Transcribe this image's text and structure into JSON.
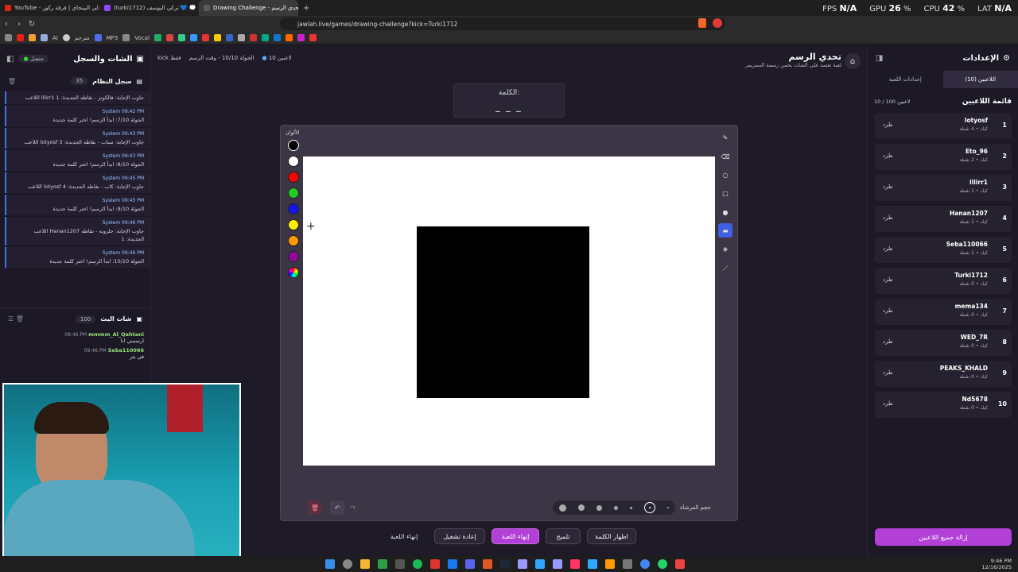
{
  "browser": {
    "tabs": [
      {
        "label": "YouTube - مبدلي البينجاي | فرقة ركوز",
        "color": "#e62117"
      },
      {
        "label": "(turki1712) تركي اليوسف 💙 💭",
        "color": "#9146ff"
      },
      {
        "label": "Drawing Challenge - تحدي الرسم",
        "color": "#5a5a5a",
        "active": true
      }
    ],
    "url": "jawlah.live/games/drawing-challenge?kick=Turki1712",
    "perf": {
      "fps_label": "FPS",
      "fps": "N/A",
      "gpu_label": "GPU",
      "gpu": "26",
      "gpu_unit": "%",
      "cpu_label": "CPU",
      "cpu": "42",
      "cpu_unit": "%",
      "lat_label": "LAT",
      "lat": "N/A"
    },
    "bookmarks": [
      "AI",
      "مترجم",
      "MP3",
      "Vocal"
    ]
  },
  "left": {
    "chat_title": "الشات والسجل",
    "status": "متصل",
    "log_title": "سجل النظام",
    "log_count": "35",
    "log": [
      {
        "text": "اللاعب lllirr1 جاوب الإجابة: فالكونز - نقاطه الجديدة: 1",
        "meta": ""
      },
      {
        "text": "الجولة 7/10: ابدأ الرسم! اختر كلمة جديدة",
        "meta": "System  09:42 PM"
      },
      {
        "text": "اللاعب lotyosf جاوب الإجابة: سناب - نقاطه الجديدة: 3",
        "meta": "System  09:43 PM"
      },
      {
        "text": "الجولة 8/10: ابدأ الرسم! اختر كلمة جديدة",
        "meta": "System  09:43 PM"
      },
      {
        "text": "اللاعب lotyosf جاوب الإجابة: كاب - نقاطه الجديدة: 4",
        "meta": "System  09:45 PM"
      },
      {
        "text": "الجولة 9/10: ابدأ الرسم! اختر كلمة جديدة",
        "meta": "System  09:45 PM"
      },
      {
        "text": "اللاعب Hanan1207 جاوب الإجابة: حلزونه - نقاطه الجديدة: 1",
        "meta": "System  09:46 PM"
      },
      {
        "text": "الجولة 10/10: ابدأ الرسم! اختر كلمة جديدة",
        "meta": "System  09:46 PM"
      }
    ],
    "live_title": "شات البث",
    "live_count": "100",
    "live": [
      {
        "name": "mmmm_Al_Qahtani",
        "time": "09:46 PM",
        "text": "ارسمني انا"
      },
      {
        "name": "Seba110066",
        "time": "09:46 PM",
        "text": "في بثر"
      }
    ]
  },
  "header": {
    "title": "تحدي الرسم",
    "subtitle": "لعبة تعتمد على الشات يخمن رسمة الستريمر",
    "players": "10 لاعبين",
    "round": "الجولة 10/10 - وقت الرسم",
    "mode": "kick فقط"
  },
  "word": {
    "label": "الكلمة:",
    "value": "_ _ _"
  },
  "colors": {
    "label": "الألوان",
    "swatches": [
      "#000000",
      "#ffffff",
      "#ff0000",
      "#22cc22",
      "#1515e8",
      "#ffee00",
      "#ff9a00",
      "#8e0a9a"
    ]
  },
  "brush": {
    "label": "حجم الفرشاة"
  },
  "actions": {
    "end": "إنهاء اللعبة",
    "restart": "إعادة تشغيل",
    "end_primary": "إنهاء اللعبة",
    "hint": "تلميح",
    "show_word": "اظهار الكلمة"
  },
  "right": {
    "title": "الإعدادات",
    "tab_players": "اللاعبين (10)",
    "tab_settings": "إعدادات اللعبة",
    "list_title": "قائمة اللاعبين",
    "count": "10 / 100 لاعبين",
    "kick_label": "طرد",
    "players": [
      {
        "rank": "1",
        "name": "lotyosf",
        "sub": "كيك • 4 نقطة"
      },
      {
        "rank": "2",
        "name": "Eto_96",
        "sub": "كيك • 2 نقطة"
      },
      {
        "rank": "3",
        "name": "lllirr1",
        "sub": "كيك • 1 نقطة"
      },
      {
        "rank": "4",
        "name": "Hanan1207",
        "sub": "كيك • 1 نقطة"
      },
      {
        "rank": "5",
        "name": "Seba110066",
        "sub": "كيك • 1 نقطة"
      },
      {
        "rank": "6",
        "name": "Turki1712",
        "sub": "كيك • 0 نقطة"
      },
      {
        "rank": "7",
        "name": "mema134",
        "sub": "كيك • 0 نقطة"
      },
      {
        "rank": "8",
        "name": "WED_7R",
        "sub": "كيك • 0 نقطة"
      },
      {
        "rank": "9",
        "name": "PEAKS_KHALD",
        "sub": "كيك • 0 نقطة"
      },
      {
        "rank": "10",
        "name": "Nd5678",
        "sub": "كيك • 0 نقطة"
      }
    ],
    "remove_all": "إزالة جميع اللاعبين"
  },
  "taskbar": {
    "time": "9:46 PM",
    "date": "12/16/2025"
  }
}
